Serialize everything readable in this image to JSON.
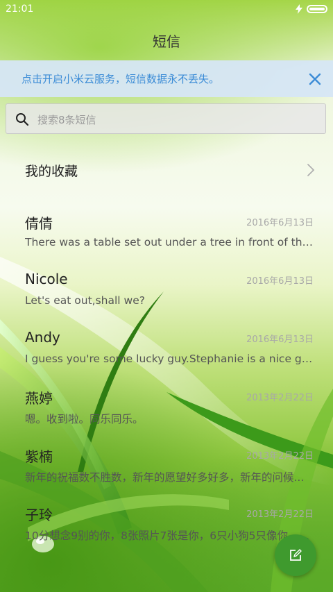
{
  "status_bar": {
    "time": "21:01"
  },
  "header": {
    "title": "短信"
  },
  "cloud_banner": {
    "text": "点击开启小米云服务，短信数据永不丢失。"
  },
  "search": {
    "placeholder": "搜索8条短信"
  },
  "favorites": {
    "label": "我的收藏"
  },
  "messages": [
    {
      "name": "倩倩",
      "date": "2016年6月13日",
      "preview": "There was a table set out under a tree in front of the ho..."
    },
    {
      "name": "Nicole",
      "date": "2016年6月13日",
      "preview": "Let's eat out,shall we?"
    },
    {
      "name": "Andy",
      "date": "2016年6月13日",
      "preview": "I guess you're some lucky guy.Stephanie is a nice girl."
    },
    {
      "name": "燕婷",
      "date": "2013年2月22日",
      "preview": "嗯。收到啦。同乐同乐。"
    },
    {
      "name": "紫楠",
      "date": "2013年2月22日",
      "preview": "新年的祝福数不胜数，新年的愿望好多好多，新年的问候..."
    },
    {
      "name": "子玲",
      "date": "2013年2月22日",
      "preview": "10分想念9别的你，8张照片7张是你，6只小狗5只像你，4..."
    }
  ],
  "colors": {
    "accent_blue": "#3a8bd6",
    "fab_green": "#3f9a2e",
    "banner_bg": "#d6e6f6"
  },
  "icons": {
    "close": "close-icon",
    "search": "search-icon",
    "chevron": "chevron-right-icon",
    "compose": "compose-icon",
    "battery": "battery-icon",
    "charging": "charging-bolt-icon"
  }
}
